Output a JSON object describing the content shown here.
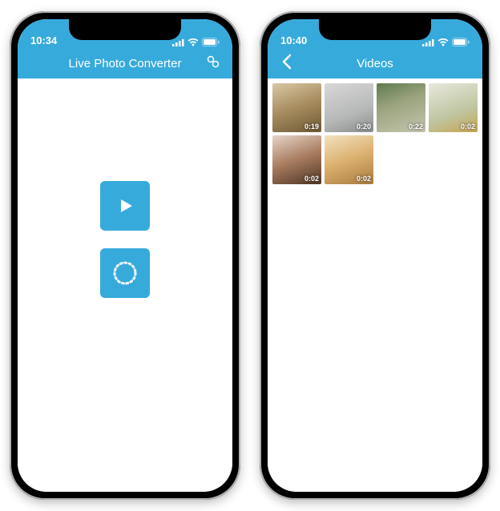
{
  "accent": "#37aadc",
  "phones": {
    "left": {
      "status": {
        "time": "10:34"
      },
      "nav": {
        "title": "Live Photo Converter"
      },
      "buttons": {
        "play": "play-icon",
        "loading": "loading-circle-icon"
      }
    },
    "right": {
      "status": {
        "time": "10:40"
      },
      "nav": {
        "title": "Videos",
        "back": "back-chevron-icon"
      },
      "videos": [
        {
          "duration": "0:19"
        },
        {
          "duration": "0:20"
        },
        {
          "duration": "0:22"
        },
        {
          "duration": "0:02"
        },
        {
          "duration": "0:02"
        },
        {
          "duration": "0:02"
        }
      ]
    }
  }
}
